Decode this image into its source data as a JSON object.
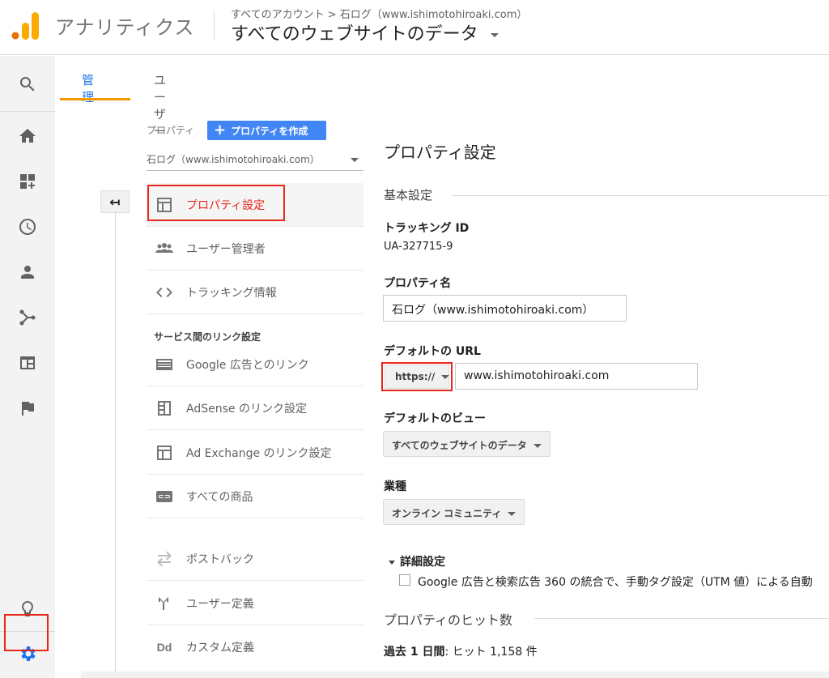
{
  "header": {
    "app_title": "アナリティクス",
    "breadcrumb_account": "すべてのアカウント",
    "breadcrumb_sep": ">",
    "breadcrumb_property": "石ログ（www.ishimotohiroaki.com）",
    "view_title": "すべてのウェブサイトのデータ"
  },
  "colors": {
    "accent_blue": "#1a73e8",
    "button_blue": "#4285f4",
    "tab_underline": "#f29900",
    "highlight_red": "#e8261b",
    "logo_orange": "#f9ab00",
    "logo_dark": "#e37400"
  },
  "rail": {
    "icons": [
      "search-icon",
      "home-icon",
      "customization-icon",
      "realtime-clock-icon",
      "audience-person-icon",
      "acquisition-icon",
      "behavior-icon",
      "conversions-flag-icon",
      "discover-lightbulb-icon",
      "admin-gear-icon"
    ]
  },
  "tabs": [
    {
      "label": "管理",
      "active": true
    },
    {
      "label": "ユーザー",
      "active": false
    }
  ],
  "property": {
    "label": "プロパティ",
    "create_button": "プロパティを作成",
    "create_plus": "+",
    "selected": "石ログ（www.ishimotohiroaki.com）"
  },
  "menu": {
    "property_settings": "プロパティ設定",
    "user_management": "ユーザー管理者",
    "tracking_info": "トラッキング情報",
    "section_linking": "サービス間のリンク設定",
    "google_ads": "Google 広告とのリンク",
    "adsense": "AdSense のリンク設定",
    "ad_exchange": "Ad Exchange のリンク設定",
    "all_products": "すべての商品",
    "postback": "ポストバック",
    "user_definitions": "ユーザー定義",
    "custom_definitions": "カスタム定義",
    "back_arrow": "↤"
  },
  "settings": {
    "title": "プロパティ設定",
    "basic_section": "基本設定",
    "tracking_id_label": "トラッキング ID",
    "tracking_id_value": "UA-327715-9",
    "property_name_label": "プロパティ名",
    "property_name_value": "石ログ（www.ishimotohiroaki.com）",
    "default_url_label": "デフォルトの URL",
    "protocol_value": "https://",
    "default_url_value": "www.ishimotohiroaki.com",
    "default_view_label": "デフォルトのビュー",
    "default_view_value": "すべてのウェブサイトのデータ",
    "industry_label": "業種",
    "industry_value": "オンライン コミュニティ",
    "advanced_label": "詳細設定",
    "advanced_checkbox_label": "Google 広告と検索広告 360 の統合で、手動タグ設定（UTM 値）による自動",
    "advanced_checkbox_checked": false,
    "hits_title": "プロパティのヒット数",
    "hits_period": "過去 1 日間",
    "hits_value": ": ヒット 1,158 件"
  }
}
